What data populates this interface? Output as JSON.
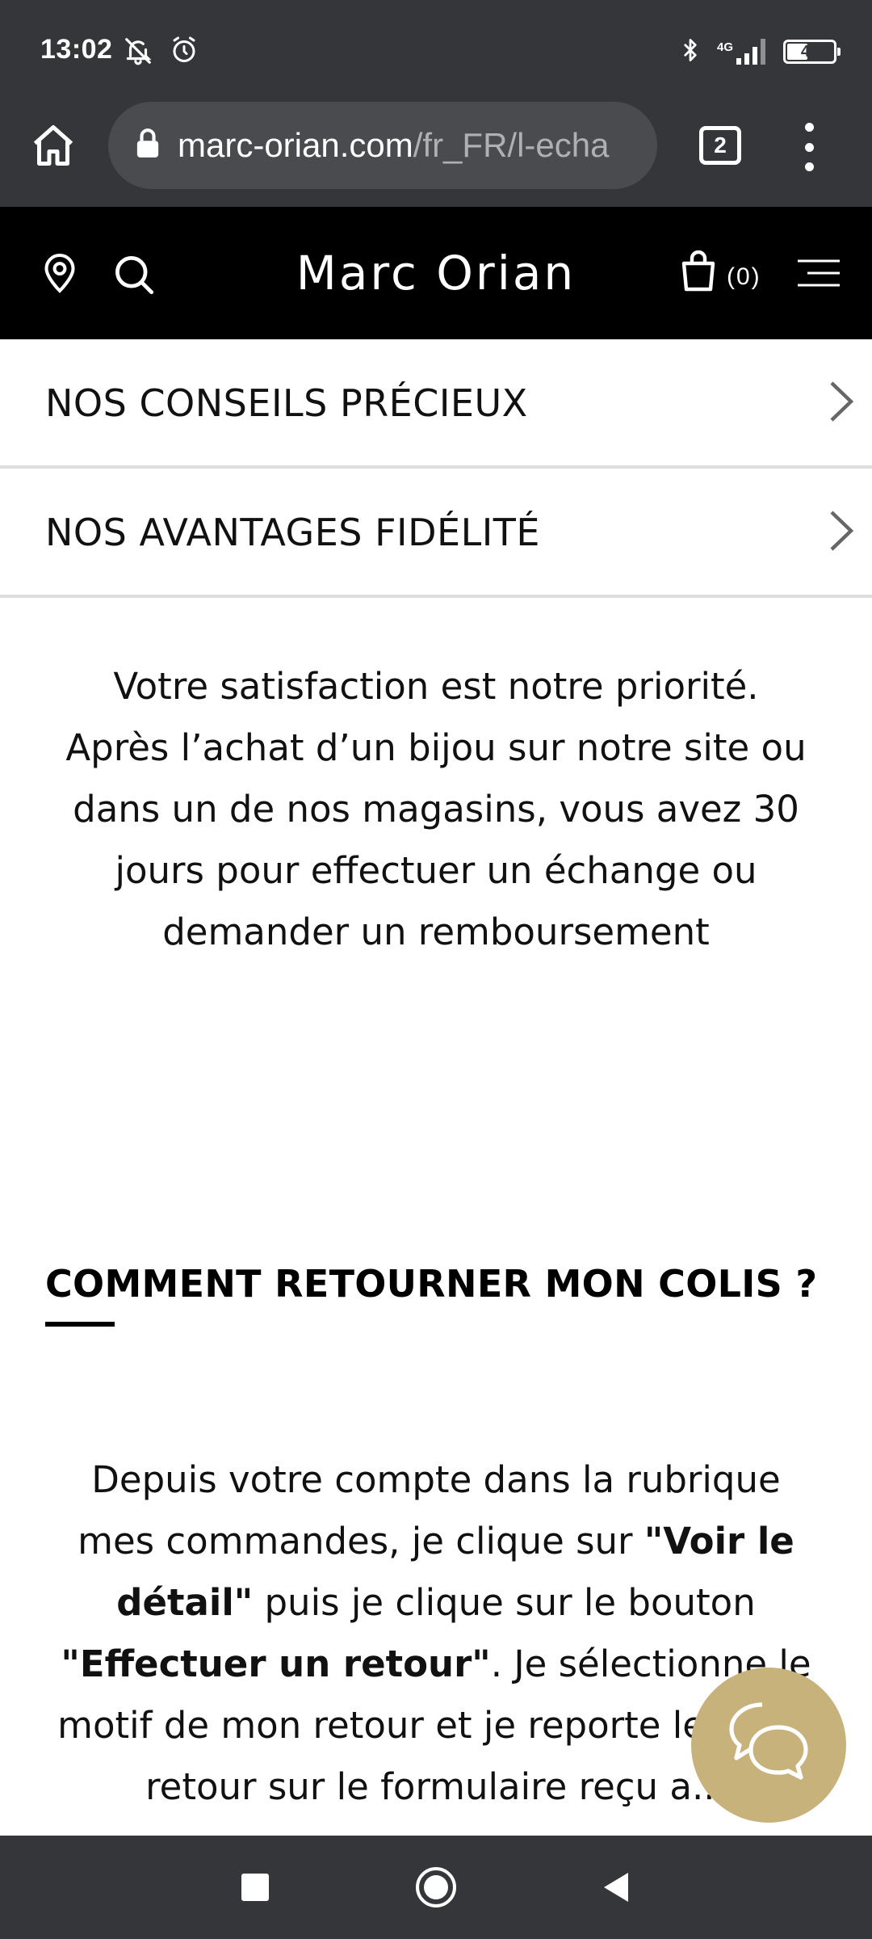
{
  "status_bar": {
    "time": "13:02",
    "network": "4G",
    "battery": "49",
    "battery_level": 0.49,
    "icons": [
      "notifications-off-icon",
      "alarm-icon",
      "bluetooth-icon",
      "signal-icon",
      "battery-icon"
    ]
  },
  "browser": {
    "url_host": "marc-orian.com",
    "url_path": "/fr_FR/l-echa",
    "tab_count": "2",
    "icons": [
      "home-icon",
      "lock-icon",
      "tabs-icon",
      "more-vert-icon"
    ]
  },
  "header": {
    "logo": "Marc Orian",
    "cart_count": "(0)",
    "icons": [
      "location-pin-icon",
      "search-icon",
      "shopping-bag-icon",
      "hamburger-menu-icon"
    ]
  },
  "accordion": [
    {
      "label": "NOS CONSEILS PRÉCIEUX"
    },
    {
      "label": "NOS AVANTAGES FIDÉLITÉ"
    }
  ],
  "intro": {
    "text": "Votre satisfaction est notre priorité. Après l’achat d’un bijou sur notre site ou dans un de nos magasins, vous avez 30 jours pour effectuer un échange ou demander un remboursement"
  },
  "return_section": {
    "title": "COMMENT RETOURNER MON COLIS ?",
    "text_1": "Depuis votre compte dans la rubrique mes commandes, je clique sur ",
    "bold_1": "\"Voir le détail\"",
    "text_2": " puis je clique sur le bouton ",
    "bold_2": "\"Effectuer un retour\"",
    "text_3": ". Je sélectionne le motif de mon retour et je reporte le n° de retour sur le formulaire reçu a..."
  },
  "chat": {
    "icon": "chat-bubbles-icon",
    "color": "#c7b27b"
  },
  "nav_bar": {
    "icons": [
      "recent-apps-icon",
      "home-circle-icon",
      "back-icon"
    ]
  }
}
